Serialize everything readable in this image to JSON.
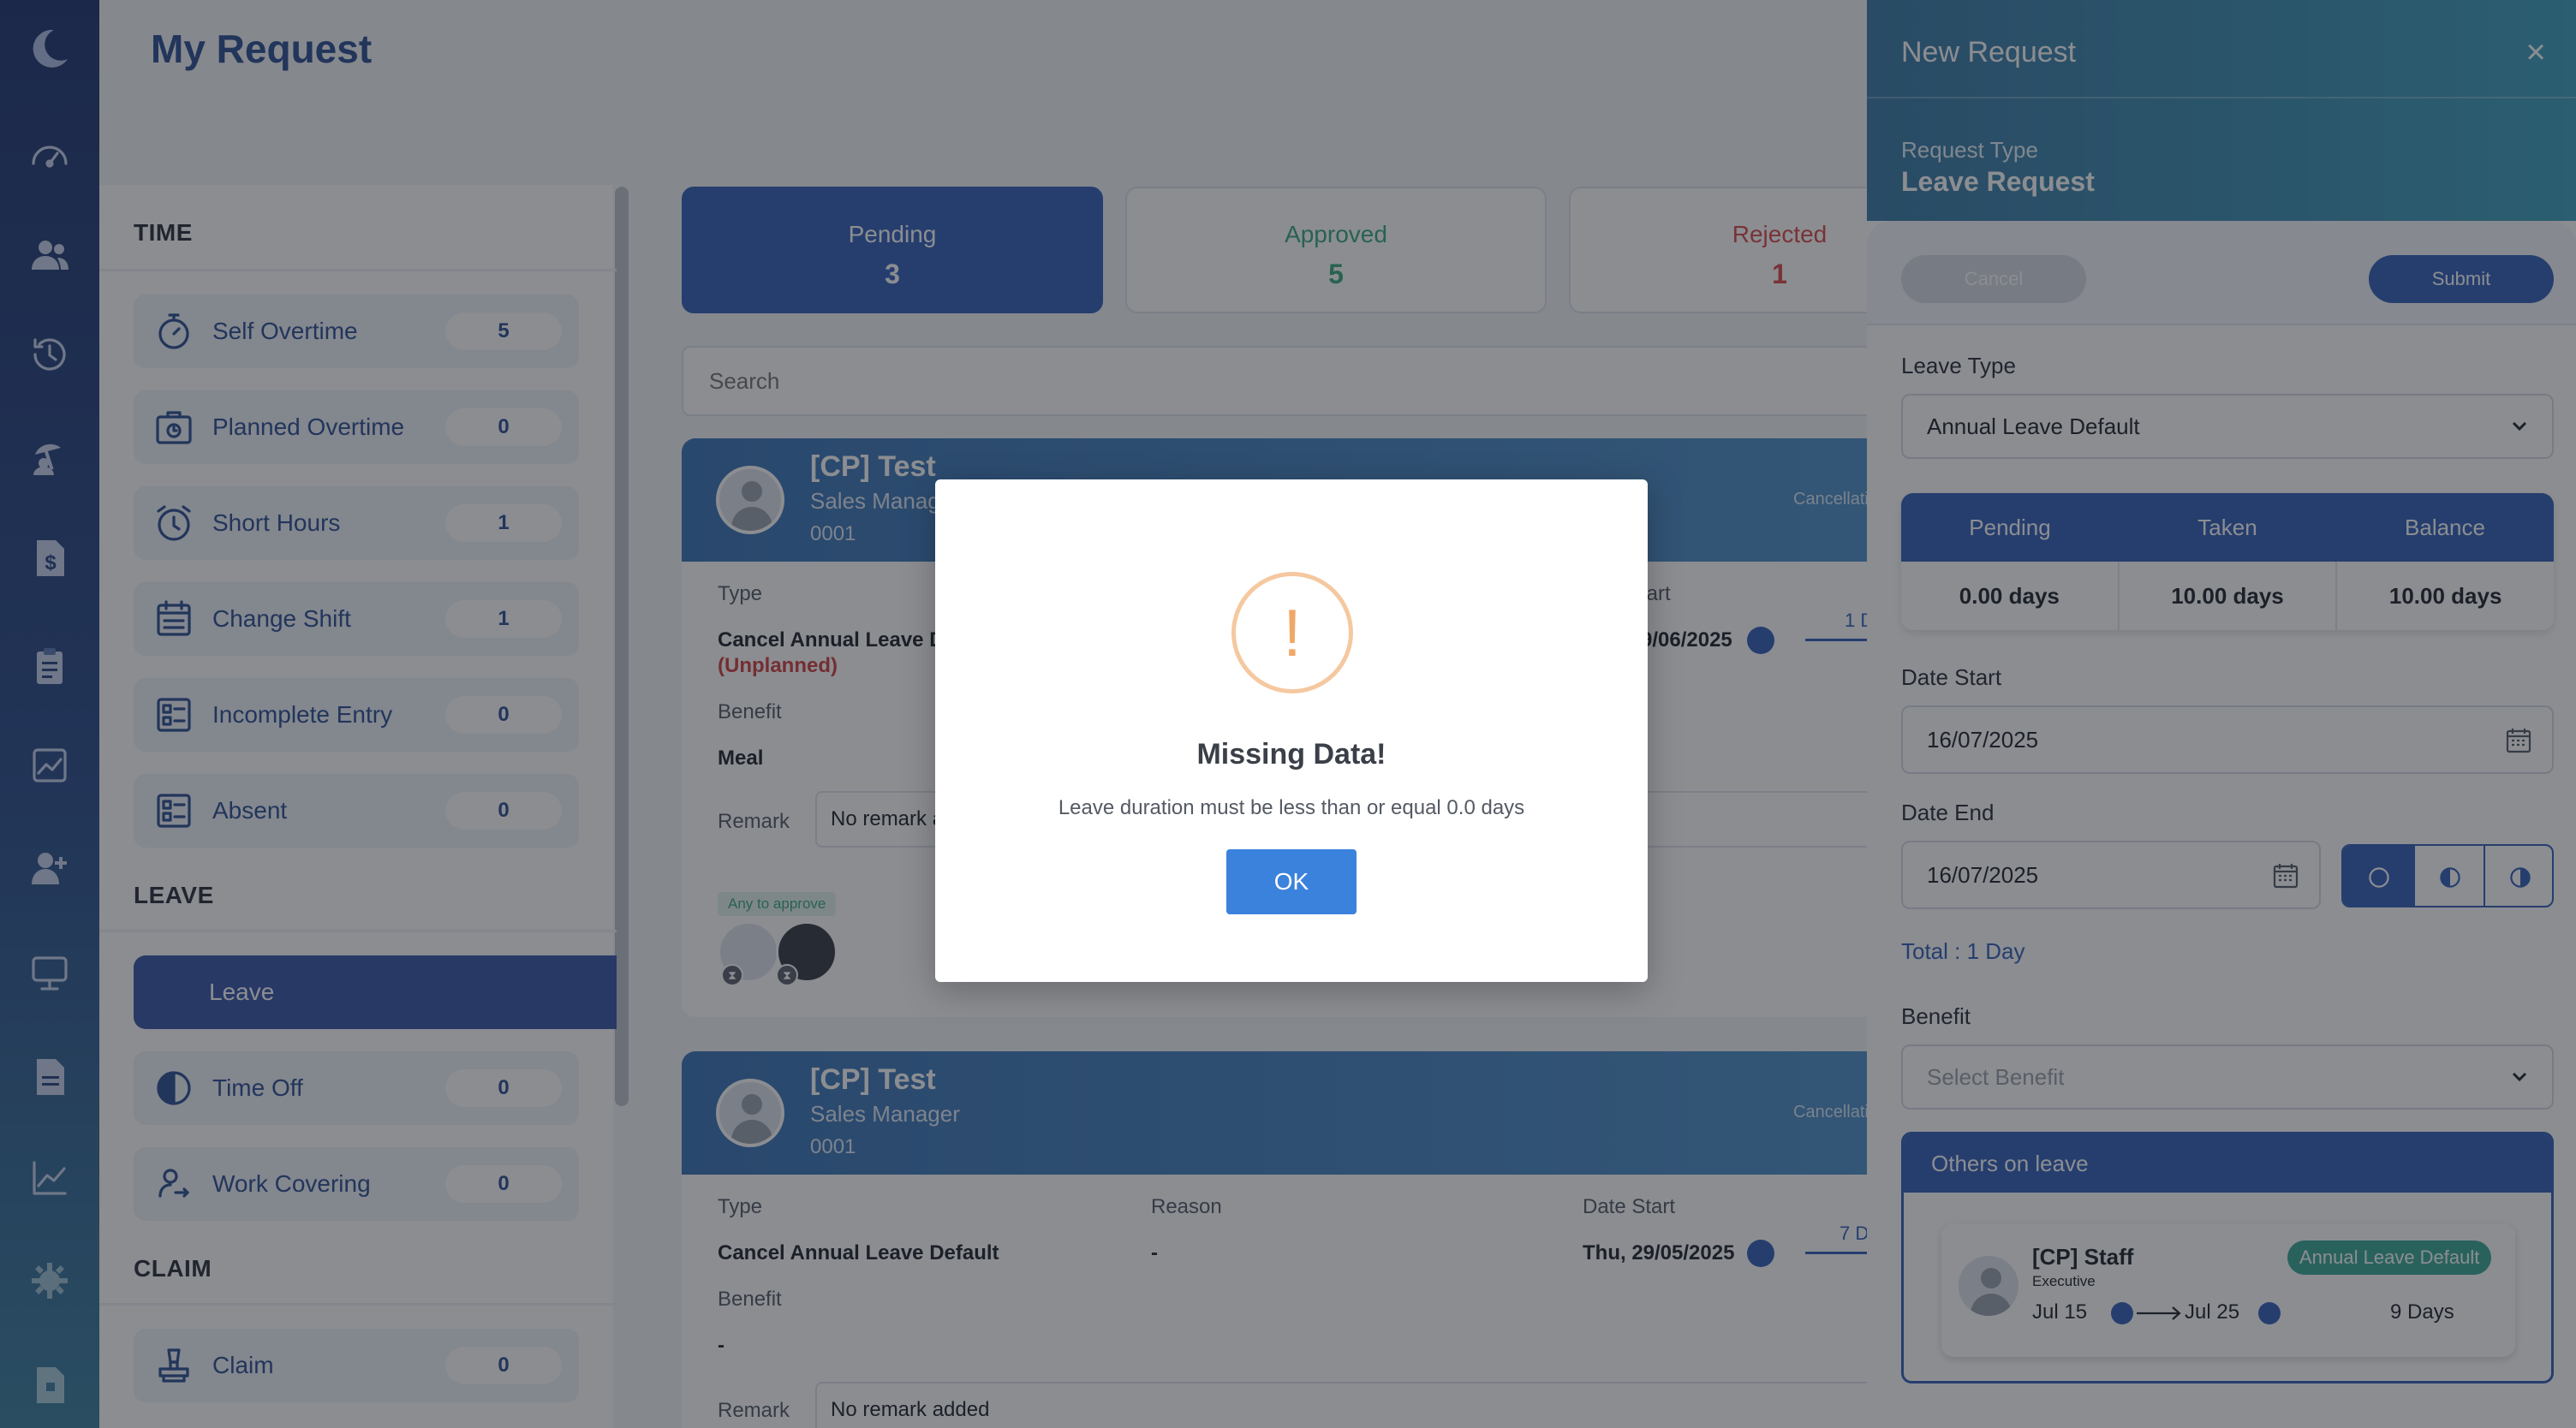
{
  "page": {
    "title": "My Request"
  },
  "categories": {
    "time_label": "TIME",
    "leave_label": "LEAVE",
    "claim_label": "CLAIM",
    "time_items": [
      {
        "label": "Self Overtime",
        "count": "5",
        "icon": "stopwatch-icon"
      },
      {
        "label": "Planned Overtime",
        "count": "0",
        "icon": "briefcase-clock-icon"
      },
      {
        "label": "Short Hours",
        "count": "1",
        "icon": "alarm-clock-icon"
      },
      {
        "label": "Change Shift",
        "count": "1",
        "icon": "calendar-list-icon"
      },
      {
        "label": "Incomplete Entry",
        "count": "0",
        "icon": "checklist-icon"
      },
      {
        "label": "Absent",
        "count": "0",
        "icon": "checklist-icon"
      }
    ],
    "leave_items": [
      {
        "label": "Leave",
        "active": true
      },
      {
        "label": "Time Off",
        "count": "0",
        "icon": "half-moon-icon"
      },
      {
        "label": "Work Covering",
        "count": "0",
        "icon": "person-swap-icon"
      }
    ],
    "claim_items": [
      {
        "label": "Claim",
        "count": "0",
        "icon": "stamp-icon"
      }
    ]
  },
  "tabs": [
    {
      "label": "Pending",
      "count": "3"
    },
    {
      "label": "Approved",
      "count": "5"
    },
    {
      "label": "Rejected",
      "count": "1"
    }
  ],
  "search": {
    "placeholder": "Search"
  },
  "cards": [
    {
      "name": "[CP] Test",
      "role": "Sales Manag",
      "id": "0001",
      "status": "Cancellati",
      "type_label": "Type",
      "type_value": "Cancel Annual Leave D",
      "type_note": "(Unplanned)",
      "date_label": "tart",
      "date_value": "9/06/2025",
      "duration": "1 D",
      "benefit_label": "Benefit",
      "benefit_value": "Meal",
      "remark_label": "Remark",
      "remark_value": "No remark a",
      "approve_tag": "Any to approve"
    },
    {
      "name": "[CP] Test",
      "role": "Sales Manager",
      "id": "0001",
      "status": "Cancellati",
      "type_label": "Type",
      "type_value": "Cancel Annual Leave Default",
      "reason_label": "Reason",
      "reason_value": "-",
      "date_label": "Date Start",
      "date_value": "Thu, 29/05/2025",
      "duration": "7 D",
      "benefit_label": "Benefit",
      "benefit_value": "-",
      "remark_label": "Remark",
      "remark_value": "No remark added"
    }
  ],
  "panel": {
    "title": "New Request",
    "close": "×",
    "request_type_label": "Request Type",
    "request_type_value": "Leave Request",
    "cancel_label": "Cancel",
    "submit_label": "Submit",
    "leave_type_label": "Leave Type",
    "leave_type_value": "Annual Leave Default",
    "balance": {
      "headers": [
        "Pending",
        "Taken",
        "Balance"
      ],
      "values": [
        "0.00 days",
        "10.00 days",
        "10.00 days"
      ]
    },
    "date_start_label": "Date Start",
    "date_start_value": "16/07/2025",
    "date_end_label": "Date End",
    "date_end_value": "16/07/2025",
    "total": "Total : 1 Day",
    "benefit_label": "Benefit",
    "benefit_placeholder": "Select Benefit",
    "others_title": "Others on leave",
    "others": [
      {
        "name": "[CP] Staff",
        "role": "Executive",
        "leave_type": "Annual Leave Default",
        "from": "Jul 15",
        "to": "Jul 25",
        "days": "9 Days"
      }
    ]
  },
  "modal": {
    "icon": "!",
    "title": "Missing Data!",
    "message": "Leave duration must be less than or equal 0.0 days",
    "ok_label": "OK"
  },
  "colors": {
    "accent": "#3461b9",
    "approved": "#3aa97c",
    "rejected": "#d94b4b",
    "warning": "#f0a868"
  }
}
